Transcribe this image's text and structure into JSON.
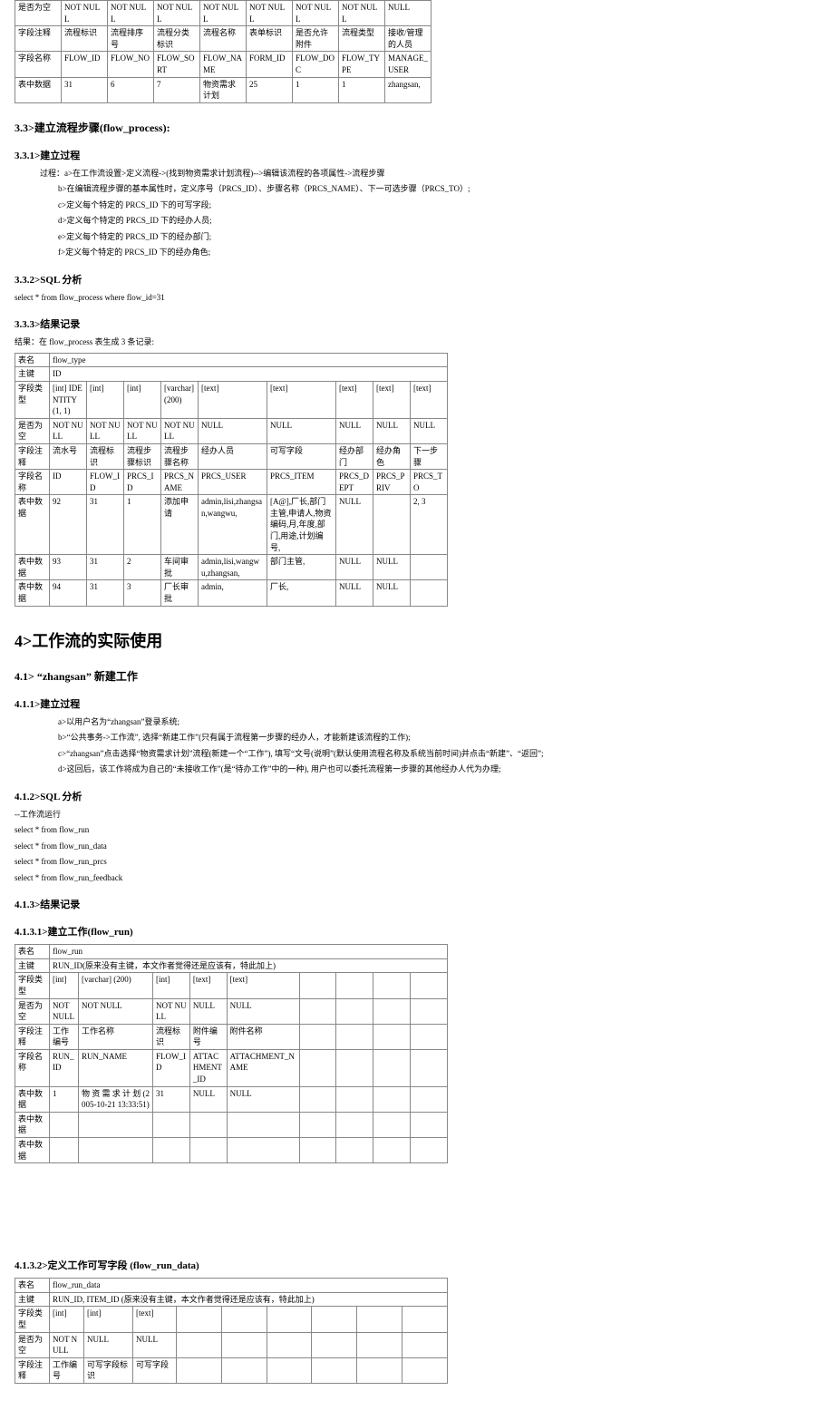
{
  "t1": {
    "r1": [
      "是否为空",
      "NOT NULL",
      "NOT NULL",
      "NOT NULL",
      "NOT NULL",
      "NOT NULL",
      "NOT NULL",
      "NOT NULL",
      "NULL"
    ],
    "r2": [
      "字段注释",
      "流程标识",
      "流程排序号",
      "流程分类标识",
      "流程名称",
      "表单标识",
      "是否允许附件",
      "流程类型",
      "接收/管理的人员"
    ],
    "r3": [
      "字段名称",
      "FLOW_ID",
      "FLOW_NO",
      "FLOW_SORT",
      "FLOW_NAME",
      "FORM_ID",
      "FLOW_DOC",
      "FLOW_TYPE",
      "MANAGE_USER"
    ],
    "r4": [
      "表中数据",
      "31",
      "6",
      "7",
      "物资需求计划",
      "25",
      "1",
      "1",
      "zhangsan,"
    ]
  },
  "s33": "3.3>建立流程步骤(flow_process):",
  "s331": "3.3.1>建立过程",
  "proc": {
    "lead": "过程：a>在工作流设置>定义流程->(找到物资需求计划流程)-->编辑该流程的各项属性->流程步骤",
    "b": "b>在编辑流程步骤的基本属性时，定义序号（PRCS_ID）、步骤名称（PRCS_NAME）、下一可选步骤（PRCS_TO）;",
    "c": "c>定义每个特定的 PRCS_ID 下的可写字段;",
    "d": "d>定义每个特定的 PRCS_ID 下的经办人员;",
    "e": "e>定义每个特定的 PRCS_ID 下的经办部门;",
    "f": "f>定义每个特定的 PRCS_ID 下的经办角色;"
  },
  "s332": "3.3.2>SQL 分析",
  "sql332": "select * from flow_process where flow_id=31",
  "s333": "3.3.3>结果记录",
  "res333": "结果：在 flow_process 表生成 3 条记录:",
  "t2": {
    "r1a": "表名",
    "r1b": "flow_type",
    "r2a": "主键",
    "r2b": "ID",
    "r3": [
      "字段类型",
      "[int] IDENTITY (1, 1)",
      "[int]",
      "[int]",
      "[varchar] (200)",
      "[text]",
      "[text]",
      "[text]",
      "[text]",
      "[text]"
    ],
    "r4": [
      "是否为空",
      "NOT NULL",
      "NOT NULL",
      "NOT NULL",
      "NOT NULL",
      "NULL",
      "NULL",
      "NULL",
      "NULL",
      "NULL"
    ],
    "r5": [
      "字段注释",
      "流水号",
      "流程标识",
      "流程步骤标识",
      "流程步骤名称",
      "经办人员",
      "可写字段",
      "经办部门",
      "经办角色",
      "下一步骤"
    ],
    "r6": [
      "字段名称",
      "ID",
      "FLOW_ID",
      "PRCS_ID",
      "PRCS_NAME",
      "PRCS_USER",
      "PRCS_ITEM",
      "PRCS_DEPT",
      "PRCS_PRIV",
      "PRCS_TO"
    ],
    "r7": [
      "表中数据",
      "92",
      "31",
      "1",
      "添加申请",
      "admin,lisi,zhangsan,wangwu,",
      "[A@],厂长,部门主管,申请人,物资编码,月,年度,部门,用途,计划编号,",
      "NULL",
      "",
      "2, 3"
    ],
    "r8": [
      "表中数据",
      "93",
      "31",
      "2",
      "车间审批",
      "admin,lisi,wangwu,zhangsan,",
      "部门主管,",
      "NULL",
      "NULL",
      ""
    ],
    "r9": [
      "表中数据",
      "94",
      "31",
      "3",
      "厂长审批",
      "admin,",
      "厂长,",
      "NULL",
      "NULL",
      ""
    ]
  },
  "s4": "4>工作流的实际使用",
  "s41": "4.1> “zhangsan” 新建工作",
  "s411": "4.1.1>建立过程",
  "p411": {
    "a": "a>以用户名为“zhangsan”登录系统;",
    "b": "b>“公共事务->工作流”, 选择“新建工作”(只有属于流程第一步骤的经办人，才能新建该流程的工作);",
    "c": "c>“zhangsan”点击选择“物资需求计划”流程(新建一个“工作”), 填写“文号(说明”(默认使用流程名称及系统当前时间)并点击“新建”、“返回”;",
    "d": "d>这回后，该工作将成为自己的“未接收工作”(是“待办工作”中的一种), 用户也可以委托流程第一步骤的其他经办人代为办理;"
  },
  "s412": "4.1.2>SQL 分析",
  "sqltxt": {
    "a": "--工作流运行",
    "b": "select * from flow_run",
    "c": "select * from flow_run_data",
    "d": "select * from flow_run_prcs",
    "e": "select * from flow_run_feedback"
  },
  "s413": "4.1.3>结果记录",
  "s4131": "4.1.3.1>建立工作(flow_run)",
  "t3": {
    "r1a": "表名",
    "r1b": "flow_run",
    "r2a": "主键",
    "r2b": "RUN_ID(原来没有主键，本文作者觉得还是应该有，特此加上)",
    "r3": [
      "字段类型",
      "[int]",
      "[varchar] (200)",
      "[int]",
      "[text]",
      "[text]",
      "",
      "",
      "",
      ""
    ],
    "r4": [
      "是否为空",
      "NOT NULL",
      "NOT NULL",
      "NOT NULL",
      "NULL",
      "NULL",
      "",
      "",
      "",
      ""
    ],
    "r5": [
      "字段注释",
      "工作编号",
      "工作名称",
      "流程标识",
      "附件编号",
      "附件名称",
      "",
      "",
      "",
      ""
    ],
    "r6": [
      "字段名称",
      "RUN_ID",
      "RUN_NAME",
      "FLOW_ID",
      "ATTACHMENT_ID",
      "ATTACHMENT_NAME",
      "",
      "",
      "",
      ""
    ],
    "r7": [
      "表中数据",
      "1",
      "物 资 需 求 计 划 (2005-10-21 13:33:51)",
      "31",
      "NULL",
      "NULL",
      "",
      "",
      "",
      ""
    ],
    "r8": [
      "表中数据",
      "",
      "",
      "",
      "",
      "",
      "",
      "",
      "",
      ""
    ],
    "r9": [
      "表中数据",
      "",
      "",
      "",
      "",
      "",
      "",
      "",
      "",
      ""
    ]
  },
  "s4132": "4.1.3.2>定义工作可写字段  (flow_run_data)",
  "t4": {
    "r1a": "表名",
    "r1b": "flow_run_data",
    "r2a": "主键",
    "r2b": "RUN_ID, ITEM_ID  (原来没有主键，本文作者觉得还是应该有，特此加上)",
    "r3": [
      "字段类型",
      "[int]",
      "[int]",
      "[text]",
      "",
      "",
      "",
      "",
      "",
      ""
    ],
    "r4": [
      "是否为空",
      "NOT NULL",
      "NULL",
      "NULL",
      "",
      "",
      "",
      "",
      "",
      ""
    ],
    "r5": [
      "字段注释",
      "工作编号",
      "可写字段标识",
      "可写字段",
      "",
      "",
      "",
      "",
      "",
      ""
    ]
  }
}
